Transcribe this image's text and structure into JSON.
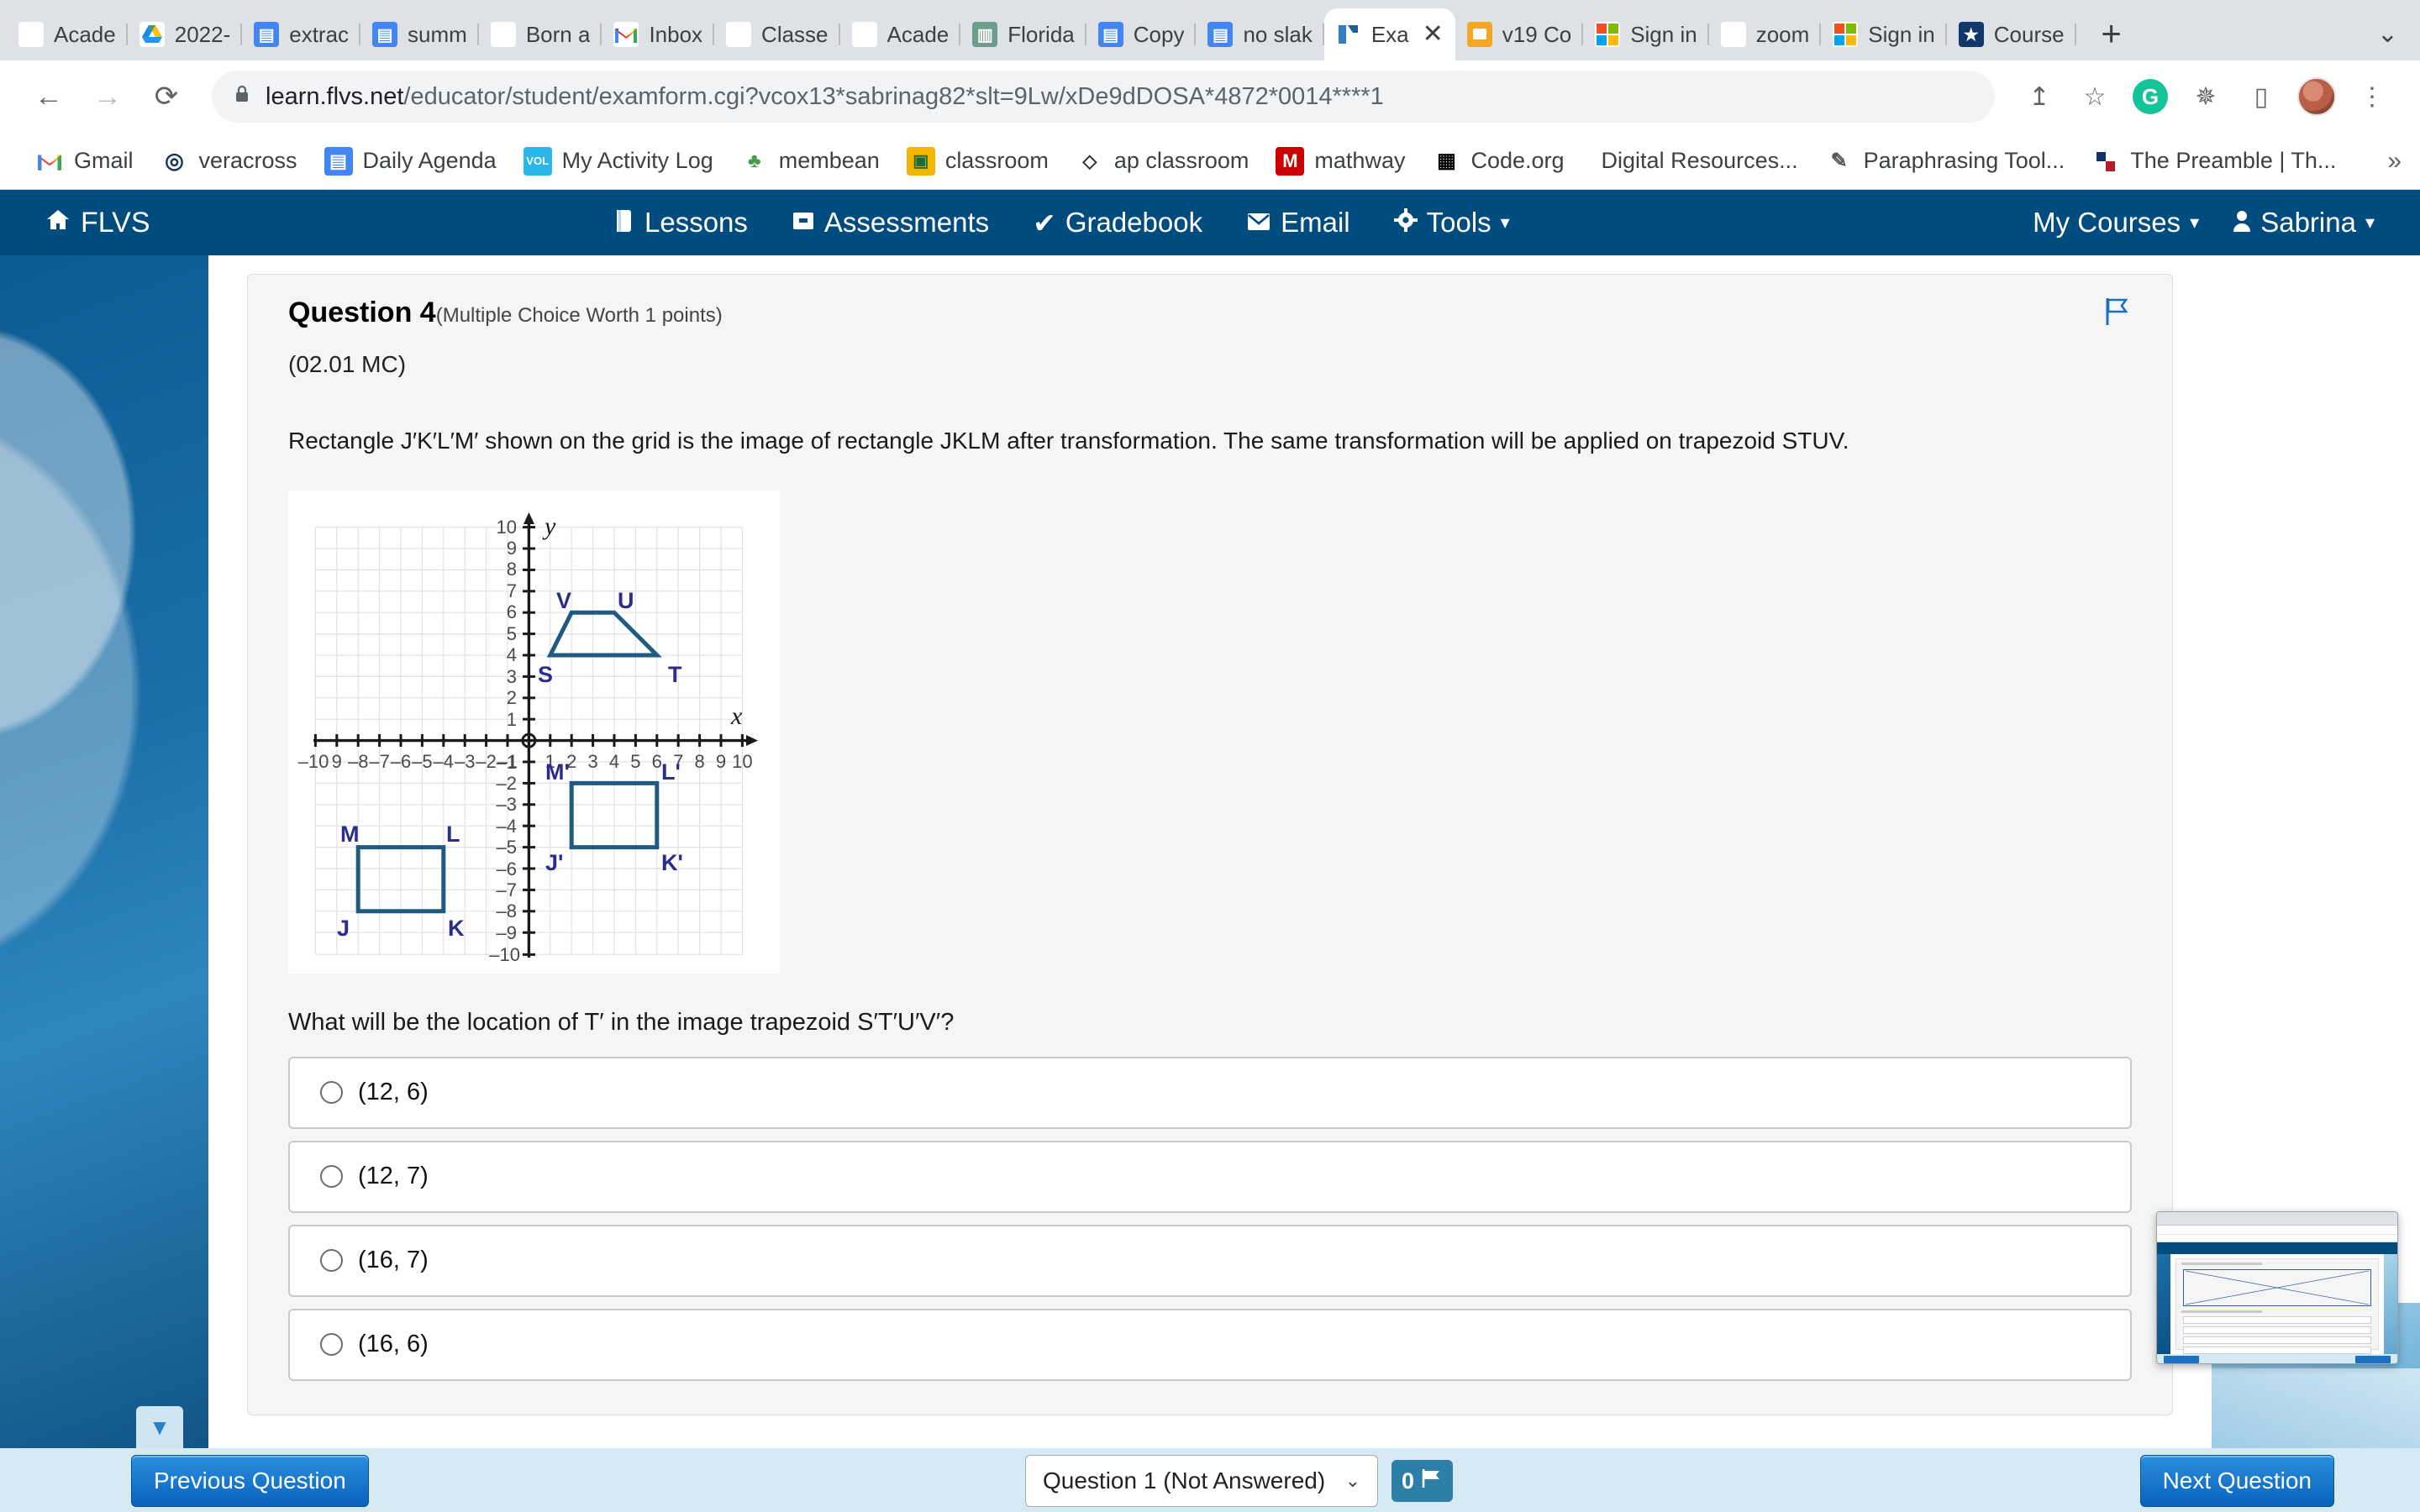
{
  "browser": {
    "tabs": [
      {
        "title": "Acade",
        "favicon": "spiral-icon",
        "favicon_class": "fi-spiral",
        "glyph": "◎",
        "active": false
      },
      {
        "title": "2022-",
        "favicon": "google-drive-icon",
        "favicon_class": "fi-drive",
        "glyph": "▲",
        "active": false
      },
      {
        "title": "extrac",
        "favicon": "google-docs-icon",
        "favicon_class": "fi-docs",
        "glyph": "▤",
        "active": false
      },
      {
        "title": "summ",
        "favicon": "google-docs-icon",
        "favicon_class": "fi-docs",
        "glyph": "▤",
        "active": false
      },
      {
        "title": "Born a",
        "favicon": "snowflake-icon",
        "favicon_class": "fi-snow",
        "glyph": "✳",
        "active": false
      },
      {
        "title": "Inbox",
        "favicon": "gmail-icon",
        "favicon_class": "fi-gmail",
        "glyph": "M",
        "active": false
      },
      {
        "title": "Classe",
        "favicon": "spiral-icon",
        "favicon_class": "fi-spiral",
        "glyph": "◎",
        "active": false
      },
      {
        "title": "Acade",
        "favicon": "spiral-icon",
        "favicon_class": "fi-spiral",
        "glyph": "◎",
        "active": false
      },
      {
        "title": "Florida",
        "favicon": "flvs-icon",
        "favicon_class": "fi-fl",
        "glyph": "▥",
        "active": false
      },
      {
        "title": "Copy",
        "favicon": "google-docs-icon",
        "favicon_class": "fi-docs",
        "glyph": "▤",
        "active": false
      },
      {
        "title": "no slak",
        "favicon": "google-docs-icon",
        "favicon_class": "fi-docs",
        "glyph": "▤",
        "active": false
      },
      {
        "title": "Exa",
        "favicon": "exam-icon",
        "favicon_class": "fi-exam",
        "glyph": "◧",
        "active": true,
        "close_label": "✕"
      },
      {
        "title": "v19 Co",
        "favicon": "orange-icon",
        "favicon_class": "fi-v19",
        "glyph": "▢",
        "active": false
      },
      {
        "title": "Sign in",
        "favicon": "microsoft-icon",
        "favicon_class": "fi-ms",
        "glyph": "▦",
        "active": false
      },
      {
        "title": "zoom",
        "favicon": "google-icon",
        "favicon_class": "fi-goog",
        "glyph": "G",
        "active": false
      },
      {
        "title": "Sign in",
        "favicon": "microsoft-icon",
        "favicon_class": "fi-ms",
        "glyph": "▦",
        "active": false
      },
      {
        "title": "Course",
        "favicon": "shield-icon",
        "favicon_class": "fi-shield",
        "glyph": "★",
        "active": false
      }
    ],
    "new_tab_label": "+",
    "tab_list_chevron": "⌄",
    "nav": {
      "back": "←",
      "forward": "→",
      "reload": "⟳"
    },
    "omnibox": {
      "lock_icon": "🔒",
      "url_domain": "learn.flvs.net",
      "url_path": "/educator/student/examform.cgi?vcox13*sabrinag82*slt=9Lw/xDe9dDOSA*4872*0014****1"
    },
    "toolbar_icons": {
      "share": "↥",
      "bookmark_star": "☆",
      "grammarly": "G",
      "extensions": "✵",
      "sidepanel": "▯",
      "menu": "⋮"
    },
    "bookmarks": [
      {
        "label": "Gmail",
        "icon": "gmail-icon",
        "glyph": "M",
        "bg": "#ffffff",
        "fg": "#ea4335"
      },
      {
        "label": "veracross",
        "icon": "spiral-icon",
        "glyph": "◎",
        "bg": "#ffffff",
        "fg": "#16365c"
      },
      {
        "label": "Daily Agenda",
        "icon": "google-docs-icon",
        "glyph": "▤",
        "bg": "#4285f4",
        "fg": "#ffffff"
      },
      {
        "label": "My Activity Log",
        "icon": "vol-icon",
        "glyph": "VOL",
        "bg": "#29b6e8",
        "fg": "#ffffff"
      },
      {
        "label": "membean",
        "icon": "tree-icon",
        "glyph": "♣",
        "bg": "#ffffff",
        "fg": "#4c9a4c"
      },
      {
        "label": "classroom",
        "icon": "classroom-icon",
        "glyph": "▣",
        "bg": "#f4b400",
        "fg": "#1a6b3c"
      },
      {
        "label": "ap classroom",
        "icon": "apple-icon",
        "glyph": "◇",
        "bg": "#ffffff",
        "fg": "#333333"
      },
      {
        "label": "mathway",
        "icon": "mathway-icon",
        "glyph": "M",
        "bg": "#cc0000",
        "fg": "#ffffff"
      },
      {
        "label": "Code.org",
        "icon": "code-org-icon",
        "glyph": "▦",
        "bg": "#ffffff",
        "fg": "#000000"
      },
      {
        "label": "Digital Resources...",
        "icon": "none-icon",
        "glyph": "",
        "bg": "transparent",
        "fg": "#000000"
      },
      {
        "label": "Paraphrasing Tool...",
        "icon": "quill-icon",
        "glyph": "✎",
        "bg": "#ffffff",
        "fg": "#555555"
      },
      {
        "label": "The Preamble | Th...",
        "icon": "preamble-icon",
        "glyph": "▪",
        "bg": "#ffffff",
        "fg": "#14306b"
      }
    ],
    "bookmarks_overflow": "»"
  },
  "flvs": {
    "brand": "FLVS",
    "brand_icon": "home-icon",
    "nav_links": [
      {
        "label": "Lessons",
        "icon": "book-icon",
        "glyph": "📕"
      },
      {
        "label": "Assessments",
        "icon": "inbox-tray-icon",
        "glyph": "🗁"
      },
      {
        "label": "Gradebook",
        "icon": "check-icon",
        "glyph": "✔"
      },
      {
        "label": "Email",
        "icon": "envelope-icon",
        "glyph": "✉"
      },
      {
        "label": "Tools",
        "icon": "gear-icon",
        "glyph": "✿",
        "has_caret": true
      }
    ],
    "my_courses": "My Courses",
    "user_name": "Sabrina",
    "user_icon": "person-icon",
    "caret": "▾"
  },
  "question": {
    "number_label": "Question 4",
    "meta_label": "(Multiple Choice Worth 1 points)",
    "flag_icon": "flag-outline-icon",
    "module_code": "(02.01 MC)",
    "stem": "Rectangle J′K′L′M′ shown on the grid is the image of rectangle JKLM after transformation. The same transformation will be applied on trapezoid STUV.",
    "prompt": "What will be the location of T′ in the image trapezoid S′T′U′V′?",
    "options": [
      {
        "label": "(12, 6)",
        "selected": false
      },
      {
        "label": "(12, 7)",
        "selected": false
      },
      {
        "label": "(16, 7)",
        "selected": false
      },
      {
        "label": "(16, 6)",
        "selected": false
      }
    ]
  },
  "chart_data": {
    "type": "scatter",
    "title": "",
    "xlabel": "x",
    "ylabel": "y",
    "xlim": [
      -10,
      10
    ],
    "ylim": [
      -10,
      10
    ],
    "grid": true,
    "x_ticks": [
      -10,
      -9,
      -8,
      -7,
      -6,
      -5,
      -4,
      -3,
      -2,
      -1,
      1,
      2,
      3,
      4,
      5,
      6,
      7,
      8,
      9,
      10
    ],
    "y_ticks": [
      -10,
      -9,
      -8,
      -7,
      -6,
      -5,
      -4,
      -3,
      -2,
      -1,
      1,
      2,
      3,
      4,
      5,
      6,
      7,
      8,
      9,
      10
    ],
    "shape_color": "#1f5b80",
    "label_color": "#2c2c8c",
    "shapes": [
      {
        "name": "rectangle JKLM",
        "vertices": [
          {
            "label": "J",
            "x": -8,
            "y": -8,
            "label_pos": "below-left"
          },
          {
            "label": "K",
            "x": -4,
            "y": -8,
            "label_pos": "below-right"
          },
          {
            "label": "L",
            "x": -4,
            "y": -5,
            "label_pos": "above-right"
          },
          {
            "label": "M",
            "x": -8,
            "y": -5,
            "label_pos": "above-left"
          }
        ]
      },
      {
        "name": "rectangle J'K'L'M'",
        "vertices": [
          {
            "label": "J′",
            "x": 2,
            "y": -5,
            "label_pos": "below-left"
          },
          {
            "label": "K′",
            "x": 6,
            "y": -5,
            "label_pos": "below-right"
          },
          {
            "label": "L′",
            "x": 6,
            "y": -2,
            "label_pos": "above-right"
          },
          {
            "label": "M′",
            "x": 2,
            "y": -2,
            "label_pos": "above-left"
          }
        ]
      },
      {
        "name": "trapezoid STUV",
        "vertices": [
          {
            "label": "S",
            "x": 1,
            "y": 4,
            "label_pos": "below-left"
          },
          {
            "label": "T",
            "x": 6,
            "y": 4,
            "label_pos": "below-right"
          },
          {
            "label": "U",
            "x": 4,
            "y": 6,
            "label_pos": "above-right"
          },
          {
            "label": "V",
            "x": 2,
            "y": 6,
            "label_pos": "above-left"
          }
        ]
      }
    ]
  },
  "footer": {
    "previous_label": "Previous Question",
    "next_label": "Next Question",
    "question_select_value": "Question 1 (Not Answered)",
    "select_chevron": "⌄",
    "flag_count": "0",
    "flag_icon": "flag-solid-icon",
    "collapse_icon": "▼"
  }
}
